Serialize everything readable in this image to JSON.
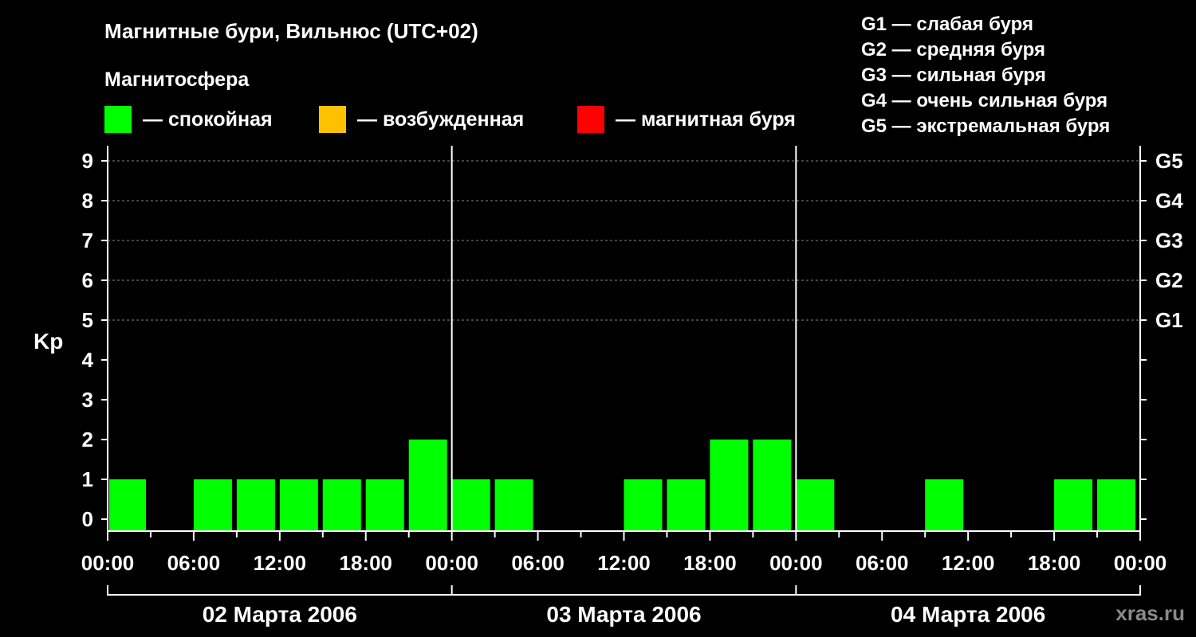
{
  "header": {
    "title": "Магнитные бури, Вильнюс (UTC+02)",
    "subtitle": "Магнитосфера"
  },
  "legend": [
    {
      "label": "— спокойная",
      "color": "#00ff00"
    },
    {
      "label": "— возбужденная",
      "color": "#ffc000"
    },
    {
      "label": "— магнитная буря",
      "color": "#ff0000"
    }
  ],
  "g_legend": [
    "G1 — слабая буря",
    "G2 — средняя буря",
    "G3 — сильная буря",
    "G4 — очень сильная буря",
    "G5 — экстремальная буря"
  ],
  "watermark": "xras.ru",
  "chart_data": {
    "type": "bar",
    "ylabel": "Kp",
    "ylim": [
      0,
      9
    ],
    "yticks": [
      "0",
      "1",
      "2",
      "3",
      "4",
      "5",
      "6",
      "7",
      "8",
      "9"
    ],
    "right_ticks": [
      {
        "value": 5,
        "label": "G1"
      },
      {
        "value": 6,
        "label": "G2"
      },
      {
        "value": 7,
        "label": "G3"
      },
      {
        "value": 8,
        "label": "G4"
      },
      {
        "value": 9,
        "label": "G5"
      }
    ],
    "x_tick_labels": [
      "00:00",
      "06:00",
      "12:00",
      "18:00",
      "00:00",
      "06:00",
      "12:00",
      "18:00",
      "00:00",
      "06:00",
      "12:00",
      "18:00",
      "00:00"
    ],
    "days": [
      "02 Марта 2006",
      "03 Марта 2006",
      "04 Марта 2006"
    ],
    "grid": true,
    "bar_color": "#00ff00",
    "bars": [
      {
        "day": 0,
        "hour": 0,
        "value": 1
      },
      {
        "day": 0,
        "hour": 3,
        "value": 0
      },
      {
        "day": 0,
        "hour": 6,
        "value": 1
      },
      {
        "day": 0,
        "hour": 9,
        "value": 1
      },
      {
        "day": 0,
        "hour": 12,
        "value": 1
      },
      {
        "day": 0,
        "hour": 15,
        "value": 1
      },
      {
        "day": 0,
        "hour": 18,
        "value": 1
      },
      {
        "day": 0,
        "hour": 21,
        "value": 2
      },
      {
        "day": 1,
        "hour": 0,
        "value": 1
      },
      {
        "day": 1,
        "hour": 3,
        "value": 1
      },
      {
        "day": 1,
        "hour": 6,
        "value": 0
      },
      {
        "day": 1,
        "hour": 9,
        "value": 0
      },
      {
        "day": 1,
        "hour": 12,
        "value": 1
      },
      {
        "day": 1,
        "hour": 15,
        "value": 1
      },
      {
        "day": 1,
        "hour": 18,
        "value": 2
      },
      {
        "day": 1,
        "hour": 21,
        "value": 2
      },
      {
        "day": 2,
        "hour": 0,
        "value": 1
      },
      {
        "day": 2,
        "hour": 3,
        "value": 0
      },
      {
        "day": 2,
        "hour": 6,
        "value": 0
      },
      {
        "day": 2,
        "hour": 9,
        "value": 1
      },
      {
        "day": 2,
        "hour": 12,
        "value": 0
      },
      {
        "day": 2,
        "hour": 15,
        "value": 0
      },
      {
        "day": 2,
        "hour": 18,
        "value": 1
      },
      {
        "day": 2,
        "hour": 21,
        "value": 1
      }
    ]
  }
}
